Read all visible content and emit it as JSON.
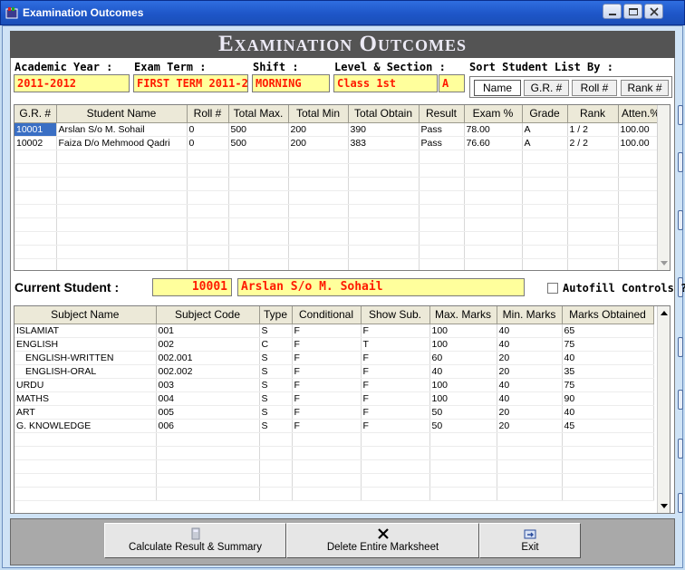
{
  "window": {
    "title": "Examination Outcomes",
    "icon": "app-icon",
    "controls": [
      "minimize-icon",
      "restore-icon",
      "close-icon"
    ]
  },
  "banner": {
    "title": "Examination Outcomes"
  },
  "filters": {
    "academic_year": {
      "label": "Academic Year :",
      "value": "2011-2012"
    },
    "exam_term": {
      "label": "Exam Term :",
      "value": "FIRST TERM 2011-2"
    },
    "shift": {
      "label": "Shift :",
      "value": "MORNING"
    },
    "level_section": {
      "label": "Level & Section :",
      "level": "Class 1st",
      "section": "A"
    },
    "sort": {
      "label": "Sort Student List By :",
      "options": [
        "Name",
        "G.R. #",
        "Roll #",
        "Rank #"
      ],
      "selected": "Name"
    }
  },
  "students": {
    "columns": [
      "G.R. #",
      "Student Name",
      "Roll #",
      "Total Max.",
      "Total Min",
      "Total Obtain",
      "Result",
      "Exam %",
      "Grade",
      "Rank",
      "Atten.%"
    ],
    "rows": [
      [
        "10001",
        "Arslan S/o M. Sohail",
        "0",
        "500",
        "200",
        "390",
        "Pass",
        "78.00",
        "A",
        "1 / 2",
        "100.00"
      ],
      [
        "10002",
        "Faiza D/o Mehmood Qadri",
        "0",
        "500",
        "200",
        "383",
        "Pass",
        "76.60",
        "A",
        "2 / 2",
        "100.00"
      ]
    ]
  },
  "current_student": {
    "label": "Current Student :",
    "gr": "10001",
    "name": "Arslan S/o M. Sohail"
  },
  "autofill": {
    "label": "Autofill Controls ?",
    "checked": false
  },
  "subjects": {
    "columns": [
      "Subject Name",
      "Subject Code",
      "Type",
      "Conditional",
      "Show Sub.",
      "Max. Marks",
      "Min. Marks",
      "Marks Obtained"
    ],
    "rows": [
      [
        "ISLAMIAT",
        "001",
        "S",
        "F",
        "F",
        "100",
        "40",
        "65"
      ],
      [
        "ENGLISH",
        "002",
        "C",
        "F",
        "T",
        "100",
        "40",
        "75"
      ],
      [
        "ENGLISH-WRITTEN",
        "002.001",
        "S",
        "F",
        "F",
        "60",
        "20",
        "40"
      ],
      [
        "ENGLISH-ORAL",
        "002.002",
        "S",
        "F",
        "F",
        "40",
        "20",
        "35"
      ],
      [
        "URDU",
        "003",
        "S",
        "F",
        "F",
        "100",
        "40",
        "75"
      ],
      [
        "MATHS",
        "004",
        "S",
        "F",
        "F",
        "100",
        "40",
        "90"
      ],
      [
        "ART",
        "005",
        "S",
        "F",
        "F",
        "50",
        "20",
        "40"
      ],
      [
        "G. KNOWLEDGE",
        "006",
        "S",
        "F",
        "F",
        "50",
        "20",
        "45"
      ]
    ]
  },
  "actions": {
    "calculate": {
      "label": "Calculate Result & Summary",
      "icon": "calculator-icon"
    },
    "delete": {
      "label": "Delete Entire Marksheet",
      "icon": "delete-x-icon"
    },
    "exit": {
      "label": "Exit",
      "icon": "exit-icon"
    }
  },
  "colors": {
    "banner_bg": "#545454",
    "field_bg": "#ffff9c",
    "field_text": "#ff1a00",
    "selection": "#3a6fc4",
    "titlebar": "#1e56c8"
  }
}
